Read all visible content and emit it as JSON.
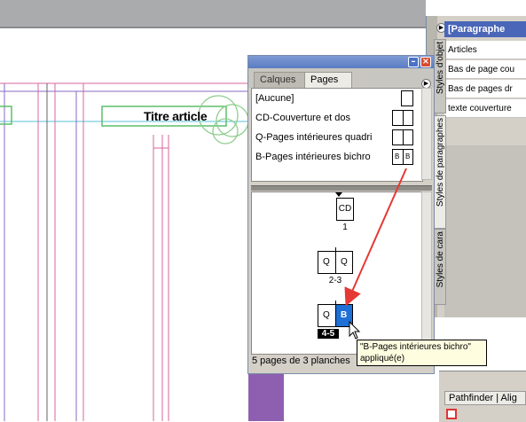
{
  "canvas": {
    "headline": "Titre article"
  },
  "pages_panel": {
    "tabs": [
      "Calques",
      "Pages"
    ],
    "masters": [
      {
        "label": "[Aucune]",
        "icon": "blank-page-icon"
      },
      {
        "label": "CD-Couverture et dos",
        "icon": "spread-page-icon"
      },
      {
        "label": "Q-Pages intérieures quadri",
        "icon": "spread-page-icon"
      },
      {
        "label": "B-Pages intérieures bichro",
        "icon": "spread-page-icon",
        "letters": [
          "B",
          "B"
        ]
      }
    ],
    "pages": [
      {
        "label": "1",
        "letters": [
          "CD"
        ]
      },
      {
        "label": "2-3",
        "letters": [
          "Q",
          "Q"
        ]
      },
      {
        "label": "4-5",
        "letters": [
          "Q",
          "B"
        ]
      }
    ],
    "status": "5 pages de 3 planches"
  },
  "tooltip": {
    "line1": "\"B-Pages intérieures bichro\"",
    "line2": "appliqué(e)"
  },
  "side_tabs": {
    "objets": "Styles d'objet",
    "paragraphes": "Styles de paragraphes",
    "caracteres": "Styles de cara"
  },
  "para_panel": {
    "header": "[Paragraphe",
    "items": [
      "Articles",
      "Bas de page cou",
      "Bas de pages dr",
      "texte couverture"
    ]
  },
  "pathfinder": {
    "tab_label": "Pathfinder",
    "tab2": "Alig"
  },
  "colors": {
    "accent_blue": "#3a5fb8",
    "highlight_blue": "#1e6fd6",
    "arrow_red": "#e53935",
    "guide_magenta": "#d9669e",
    "guide_green": "#5bbf6a"
  }
}
